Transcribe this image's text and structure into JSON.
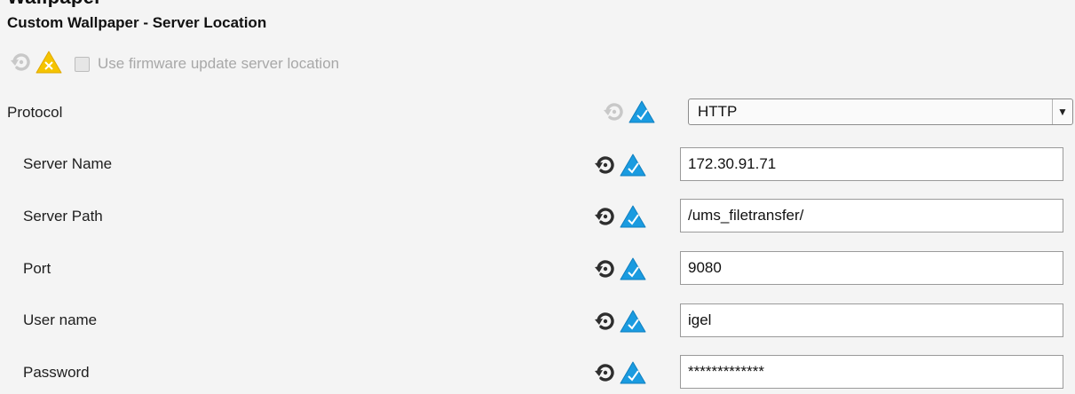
{
  "window": {
    "clipped_heading": "Wallpaper"
  },
  "section": {
    "title": "Custom Wallpaper - Server Location"
  },
  "use_firmware": {
    "label": "Use firmware update server location",
    "checked": false,
    "status": "warning"
  },
  "colors": {
    "accent_blue": "#1a9be0",
    "warning_yellow": "#f5c400",
    "reset_dark": "#2e2e2e",
    "reset_disabled": "#c8c8c8"
  },
  "icons": {
    "reset": "reset-icon",
    "confirmed": "blue-check-triangle-icon",
    "warning": "yellow-warning-triangle-icon",
    "dropdown": "chevron-down-icon"
  },
  "protocol": {
    "label": "Protocol",
    "value": "HTTP",
    "arrow": "▼"
  },
  "fields": [
    {
      "label": "Server Name",
      "value": "172.30.91.71"
    },
    {
      "label": "Server Path",
      "value": "/ums_filetransfer/"
    },
    {
      "label": "Port",
      "value": "9080"
    },
    {
      "label": "User name",
      "value": "igel"
    },
    {
      "label": "Password",
      "value": "*************"
    }
  ]
}
